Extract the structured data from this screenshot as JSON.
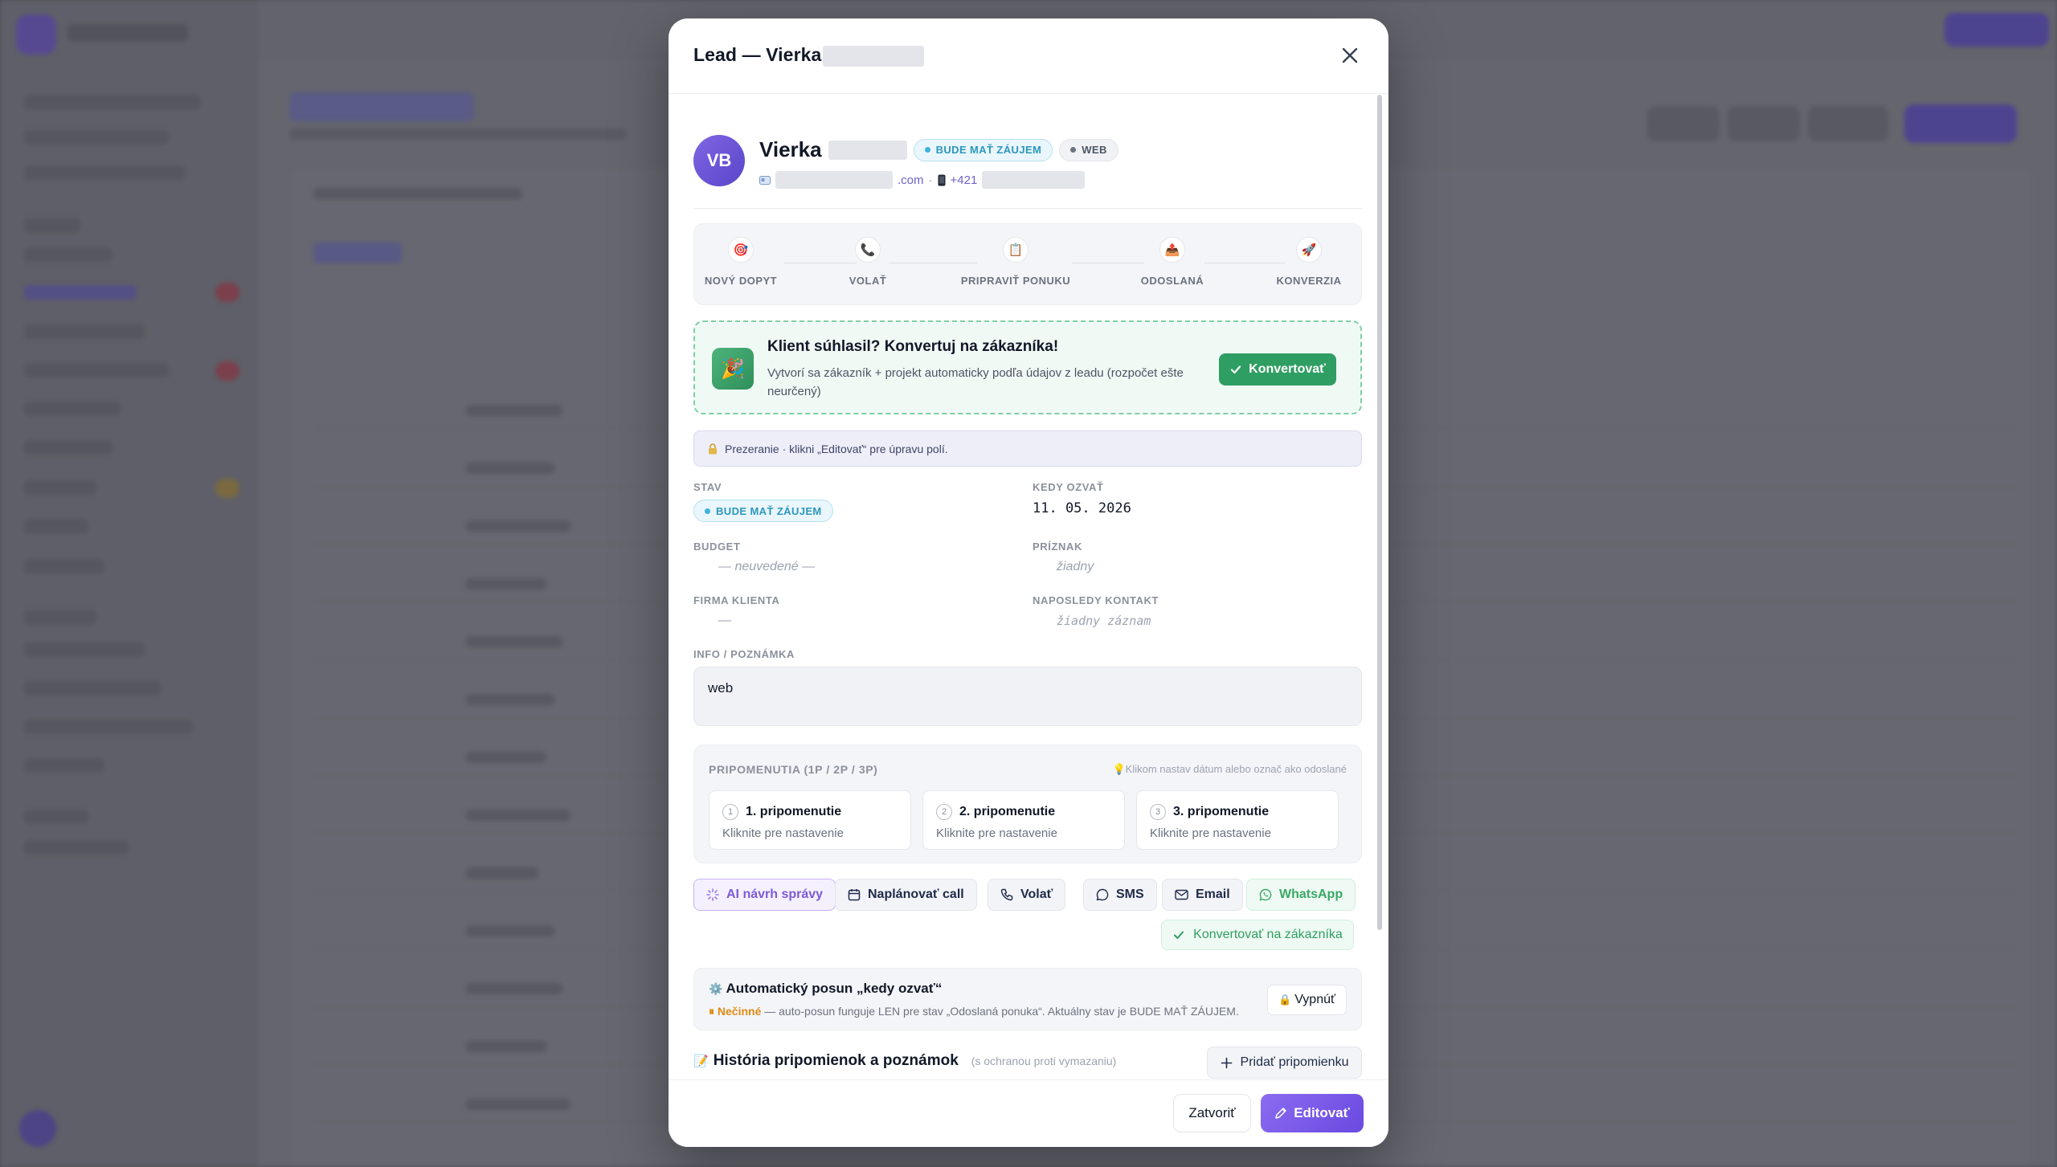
{
  "modal": {
    "title_prefix": "Lead — Vierka",
    "close_label": "×"
  },
  "lead": {
    "initials": "VB",
    "first_name": "Vierka",
    "status": "BUDE MAŤ ZÁUJEM",
    "source": "WEB",
    "email_suffix": ".com",
    "phone_prefix": "+421",
    "email_icon": "email-card-icon",
    "phone_icon": "phone-device-icon"
  },
  "pipeline": {
    "steps": [
      {
        "label": "NOVÝ DOPYT",
        "icon": "🎯"
      },
      {
        "label": "VOLAŤ",
        "icon": "📞"
      },
      {
        "label": "PRIPRAVIŤ PONUKU",
        "icon": "📋"
      },
      {
        "label": "ODOSLANÁ",
        "icon": "📤"
      },
      {
        "label": "KONVERZIA",
        "icon": "🚀"
      }
    ]
  },
  "convert": {
    "title": "Klient súhlasil? Konvertuj na zákazníka!",
    "description": "Vytvorí sa zákazník + projekt automaticky podľa údajov z leadu (rozpočet ešte neurčený)",
    "button": "Konvertovať",
    "icon": "party-popper-icon"
  },
  "view_note": "Prezeranie · klikni „Editovať“ pre úpravu polí.",
  "fields": {
    "stav_label": "STAV",
    "stav_value": "BUDE MAŤ ZÁUJEM",
    "kedy_label": "KEDY OZVAŤ",
    "kedy_value": "11. 05. 2026",
    "budget_label": "BUDGET",
    "budget_value": "— neuvedené —",
    "priznak_label": "PRÍZNAK",
    "priznak_value": "žiadny",
    "firma_label": "FIRMA KLIENTA",
    "firma_value": "—",
    "kontakt_label": "NAPOSLEDY KONTAKT",
    "kontakt_value": "žiadny záznam",
    "info_label": "INFO / POZNÁMKA",
    "info_value": "web"
  },
  "reminders": {
    "title": "PRIPOMENUTIA (1P / 2P / 3P)",
    "hint": "💡Klikom nastav dátum alebo označ ako odoslané",
    "items": [
      {
        "num": "1",
        "name": "1. pripomenutie",
        "sub": "Kliknite pre nastavenie"
      },
      {
        "num": "2",
        "name": "2. pripomenutie",
        "sub": "Kliknite pre nastavenie"
      },
      {
        "num": "3",
        "name": "3. pripomenutie",
        "sub": "Kliknite pre nastavenie"
      }
    ]
  },
  "actions": {
    "ai": "AI návrh správy",
    "schedule": "Naplánovať call",
    "call": "Volať",
    "sms": "SMS",
    "email": "Email",
    "whatsapp": "WhatsApp",
    "convert": "Konvertovať na zákazníka"
  },
  "auto_shift": {
    "title": "Automatický posun „kedy ozvať“",
    "status": "Nečinné",
    "description": " — auto-posun funguje LEN pre stav „Odoslaná ponuka“. Aktuálny stav je BUDE MAŤ ZÁUJEM.",
    "button": "Vypnúť"
  },
  "history": {
    "title": "História pripomienok a poznámok",
    "subtitle": "(s ochranou proti vymazaniu)",
    "add_button": "Pridať pripomienku"
  },
  "footer": {
    "close": "Zatvoriť",
    "edit": "Editovať"
  },
  "colors": {
    "accent": "#7c5ad6",
    "success": "#2f9e62",
    "status": "#2b97bd"
  }
}
